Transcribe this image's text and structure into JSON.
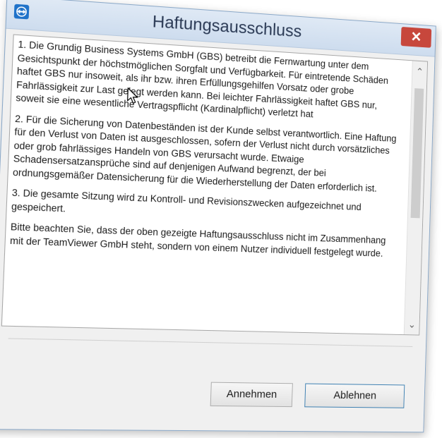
{
  "window": {
    "title": "Haftungsausschluss",
    "close_glyph": "✕",
    "app_icon": "teamviewer-icon"
  },
  "content": {
    "paragraphs": [
      "1. Die Grundig Business Systems GmbH (GBS) betreibt die Fernwartung unter dem Gesichtspunkt der höchstmöglichen Sorgfalt und Verfügbarkeit. Für eintretende Schäden haftet GBS nur insoweit, als ihr bzw. ihren Erfüllungsgehilfen Vorsatz oder grobe Fahrlässigkeit zur Last gelegt werden kann. Bei leichter Fahrlässigkeit haftet GBS nur, soweit sie eine wesentliche Vertragspflicht (Kardinalpflicht) verletzt hat",
      "2. Für die Sicherung von Datenbeständen ist der Kunde selbst verantwortlich. Eine Haftung für den Verlust von Daten ist ausgeschlossen, sofern der Verlust nicht durch vorsätzliches oder grob fahrlässiges Handeln von GBS verursacht wurde. Etwaige Schadensersatzansprüche sind auf denjenigen Aufwand begrenzt, der bei ordnungsgemäßer Datensicherung für die Wiederherstellung der Daten erforderlich ist.",
      "3. Die gesamte Sitzung wird zu Kontroll- und Revisionszwecken aufgezeichnet und gespeichert.",
      "Bitte beachten Sie, dass der oben gezeigte Haftungsausschluss nicht im Zusammenhang mit der TeamViewer GmbH steht, sondern von einem Nutzer individuell festgelegt wurde."
    ]
  },
  "scrollbar": {
    "up_glyph": "⌃",
    "down_glyph": "⌄"
  },
  "buttons": {
    "accept_label": "Annehmen",
    "decline_label": "Ablehnen"
  },
  "colors": {
    "close_button": "#c7473c",
    "title_text": "#2b3a55",
    "focus_border": "#3c7fb1"
  }
}
